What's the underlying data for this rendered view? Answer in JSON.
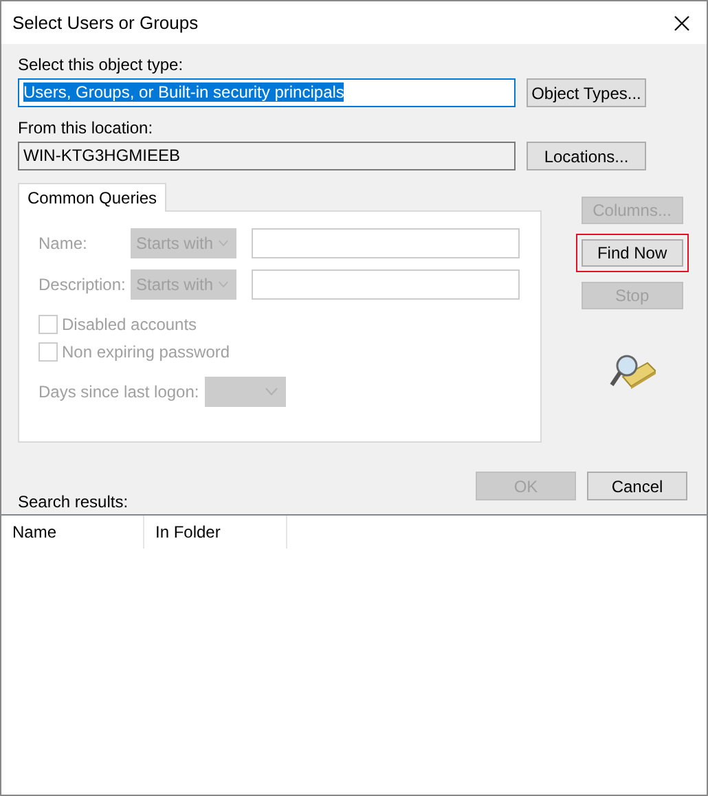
{
  "window": {
    "title": "Select Users or Groups"
  },
  "object_type": {
    "label": "Select this object type:",
    "value": "Users, Groups, or Built-in security principals",
    "selected": true,
    "button": "Object Types..."
  },
  "location": {
    "label": "From this location:",
    "value": "WIN-KTG3HGMIEEB",
    "button": "Locations..."
  },
  "tabs": [
    {
      "label": "Common Queries",
      "selected": true
    }
  ],
  "queries": [
    {
      "kind": "text",
      "label": "Name:",
      "operator": "Starts with"
    },
    {
      "kind": "text",
      "label": "Description:",
      "operator": "Starts with"
    },
    {
      "kind": "checkbox",
      "label": "Disabled accounts",
      "checked": false
    },
    {
      "kind": "checkbox",
      "label": "Non expiring password",
      "checked": false
    },
    {
      "kind": "dropdown",
      "label": "Days since last logon:"
    }
  ],
  "side_buttons": [
    {
      "label": "Columns...",
      "disabled": true,
      "highlighted": false
    },
    {
      "label": "Find Now",
      "disabled": false,
      "highlighted": true
    },
    {
      "label": "Stop",
      "disabled": true,
      "highlighted": false
    }
  ],
  "dialog_buttons": [
    {
      "label": "OK",
      "disabled": true
    },
    {
      "label": "Cancel",
      "disabled": false
    }
  ],
  "results": {
    "label": "Search results:",
    "columns": [
      "Name",
      "In Folder"
    ]
  }
}
